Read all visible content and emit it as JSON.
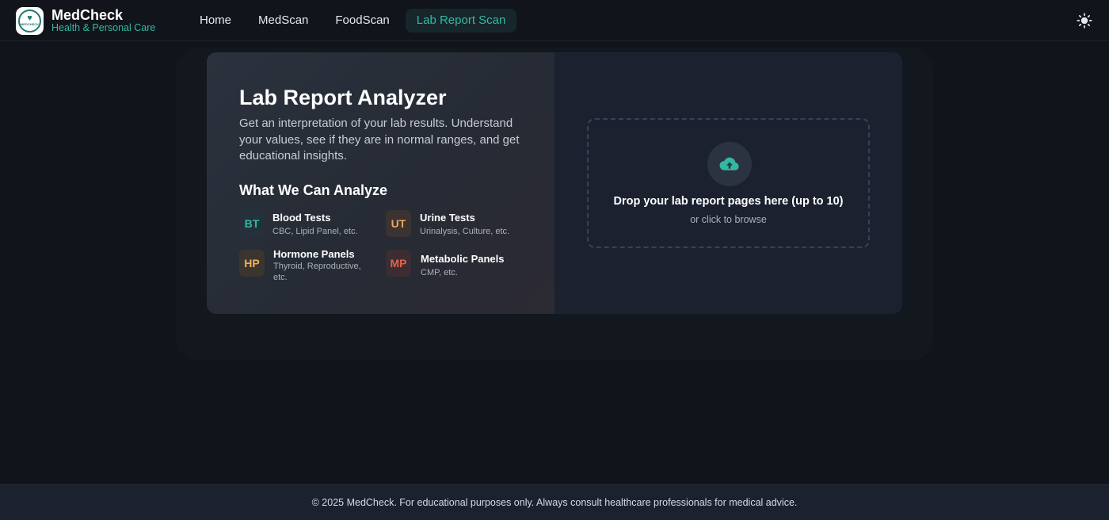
{
  "header": {
    "brand_name": "MedCheck",
    "brand_tagline": "Health & Personal Care",
    "logo_text": "MEDCHECK",
    "nav": [
      {
        "label": "Home",
        "active": false
      },
      {
        "label": "MedScan",
        "active": false
      },
      {
        "label": "FoodScan",
        "active": false
      },
      {
        "label": "Lab Report Scan",
        "active": true
      }
    ],
    "theme_icon": "sun-icon"
  },
  "main": {
    "title": "Lab Report Analyzer",
    "description": "Get an interpretation of your lab results. Understand your values, see if they are in normal ranges, and get educational insights.",
    "analyze_heading": "What We Can Analyze",
    "features": [
      {
        "badge": "BT",
        "name": "Blood Tests",
        "detail": "CBC, Lipid Panel, etc.",
        "color": "#34b7a3",
        "bg": "#24313a"
      },
      {
        "badge": "UT",
        "name": "Urine Tests",
        "detail": "Urinalysis, Culture, etc.",
        "color": "#f0a45c",
        "bg": "#3a3331"
      },
      {
        "badge": "HP",
        "name": "Hormone Panels",
        "detail": "Thyroid, Reproductive, etc.",
        "color": "#f0b15c",
        "bg": "#3b3530"
      },
      {
        "badge": "MP",
        "name": "Metabolic Panels",
        "detail": "CMP, etc.",
        "color": "#e5604e",
        "bg": "#3b2d31"
      }
    ],
    "upload": {
      "title": "Drop your lab report pages here (up to 10)",
      "subtitle": "or click to browse",
      "icon": "cloud-upload-icon"
    }
  },
  "footer": {
    "text": "© 2025 MedCheck. For educational purposes only. Always consult healthcare professionals for medical advice."
  },
  "colors": {
    "accent": "#34b7a3",
    "background": "#11151b"
  }
}
